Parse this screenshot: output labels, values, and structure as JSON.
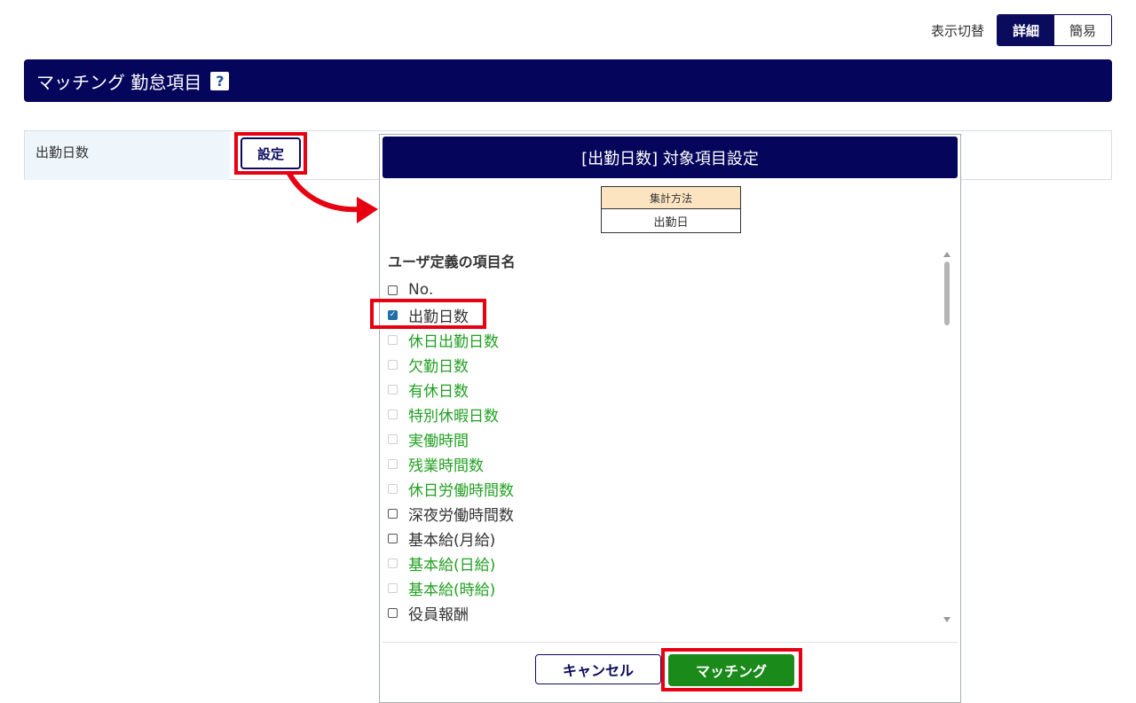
{
  "view_toggle": {
    "label": "表示切替",
    "detail": "詳細",
    "simple": "簡易"
  },
  "section": {
    "title": "マッチング 勤怠項目",
    "help_icon": "?"
  },
  "row": {
    "label": "出勤日数",
    "setting_button": "設定"
  },
  "dialog": {
    "title": "[出勤日数] 対象項目設定",
    "aggregation_header": "集計方法",
    "aggregation_value": "出勤日",
    "list_title": "ユーザ定義の項目名",
    "items": [
      {
        "label": "No.",
        "state": "unchecked",
        "color": "default"
      },
      {
        "label": "出勤日数",
        "state": "checked",
        "color": "default"
      },
      {
        "label": "休日出勤日数",
        "state": "disabled",
        "color": "green"
      },
      {
        "label": "欠勤日数",
        "state": "disabled",
        "color": "green"
      },
      {
        "label": "有休日数",
        "state": "disabled",
        "color": "green"
      },
      {
        "label": "特別休暇日数",
        "state": "disabled",
        "color": "green"
      },
      {
        "label": "実働時間",
        "state": "disabled",
        "color": "green"
      },
      {
        "label": "残業時間数",
        "state": "disabled",
        "color": "green"
      },
      {
        "label": "休日労働時間数",
        "state": "disabled",
        "color": "green"
      },
      {
        "label": "深夜労働時間数",
        "state": "unchecked",
        "color": "default"
      },
      {
        "label": "基本給(月給)",
        "state": "unchecked",
        "color": "default"
      },
      {
        "label": "基本給(日給)",
        "state": "disabled",
        "color": "green"
      },
      {
        "label": "基本給(時給)",
        "state": "disabled",
        "color": "green"
      },
      {
        "label": "役員報酬",
        "state": "unchecked",
        "color": "default"
      }
    ],
    "cancel_button": "キャンセル",
    "match_button": "マッチング"
  },
  "colors": {
    "header_navy": "#05055c",
    "highlight_red": "#e60012",
    "match_green": "#1a8a1a",
    "label_green": "#22a022"
  }
}
